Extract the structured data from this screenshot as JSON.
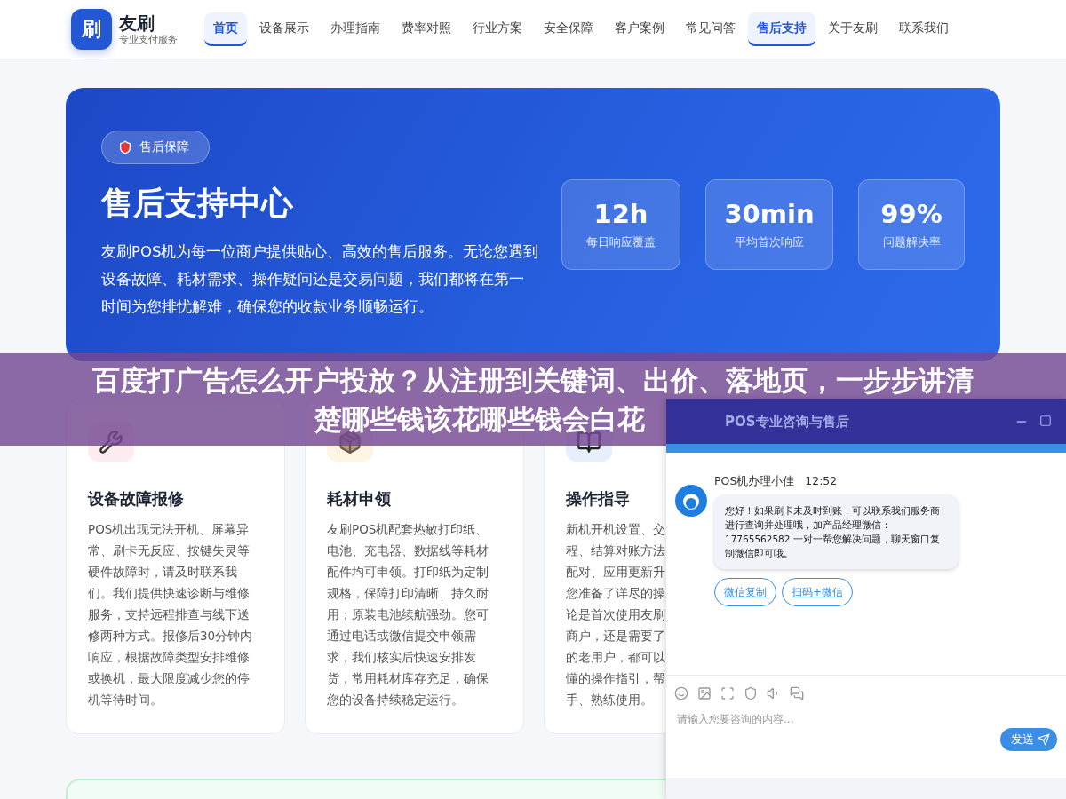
{
  "header": {
    "logo_mark": "刷",
    "brand": "友刷",
    "tagline": "专业支付服务",
    "nav": [
      {
        "label": "首页",
        "selected": true
      },
      {
        "label": "设备展示",
        "selected": false
      },
      {
        "label": "办理指南",
        "selected": false
      },
      {
        "label": "费率对照",
        "selected": false
      },
      {
        "label": "行业方案",
        "selected": false
      },
      {
        "label": "安全保障",
        "selected": false
      },
      {
        "label": "客户案例",
        "selected": false
      },
      {
        "label": "常见问答",
        "selected": false
      },
      {
        "label": "售后支持",
        "selected": true
      },
      {
        "label": "关于友刷",
        "selected": false
      },
      {
        "label": "联系我们",
        "selected": false
      }
    ]
  },
  "hero": {
    "badge": "售后保障",
    "title": "售后支持中心",
    "description_lines": [
      "友刷POS机为每一位商户提供贴心、高效的售后服务。无论您遇到",
      "设备故障、耗材需求、操作疑问还是交易问题，我们都将在第一",
      "时间为您排忧解难，确保您的收款业务顺畅运行。"
    ],
    "stats": [
      {
        "value": "12h",
        "label": "每日响应覆盖"
      },
      {
        "value": "30min",
        "label": "平均首次响应"
      },
      {
        "value": "99%",
        "label": "问题解决率"
      }
    ]
  },
  "services": [
    {
      "kind": "wrench",
      "title": "设备故障报修",
      "lines": [
        "POS机出现无法开机、屏幕异",
        "常、刷卡无反应、按键失灵等",
        "硬件故障时，请及时联系我",
        "们。我们提供快速诊断与维修",
        "服务，支持远程排查与线下送",
        "修两种方式。报修后30分钟内",
        "响应，根据故障类型安排维修",
        "或换机，最大限度减少您的停",
        "机等待时间。"
      ]
    },
    {
      "kind": "box",
      "title": "耗材申领",
      "lines": [
        "友刷POS机配套热敏打印纸、",
        "电池、充电器、数据线等耗材",
        "配件均可申领。打印纸为定制",
        "规格，保障打印清晰、持久耐",
        "用；原装电池续航强劲。您可",
        "通过电话或微信提交申领需",
        "求，我们核实后快速安排发",
        "货，常用耗材库存充足，确保",
        "您的设备持续稳定运行。"
      ]
    },
    {
      "kind": "book",
      "title": "操作指导",
      "lines": [
        "新机开机设置、交",
        "程、结算对账方法",
        "配对、应用更新升",
        "您准备了详尽的操",
        "论是首次使用友刷",
        "商户，还是需要了",
        "的老用户，都可以",
        "懂的操作指引，帮",
        "手、熟练使用。"
      ]
    }
  ],
  "overlay_title": [
    "百度打广告怎么开户投放？从注册到关键词、出价、落地页，一步步讲清",
    "楚哪些钱该花哪些钱会白花"
  ],
  "chat": {
    "title": "POS专业咨询与售后",
    "message": {
      "sender": "POS机办理小佳",
      "time": "12:52",
      "text": "您好！如果刷卡未及时到账，可以联系我们服务商进行查询并处理哦，加产品经理微信：17765562582 一对一帮您解决问题，聊天窗口复制微信即可哦。"
    },
    "actions": [
      "微信复制",
      "扫码+微信"
    ],
    "input": {
      "placeholder": "请输入您要咨询的内容..."
    },
    "send": "发送"
  }
}
